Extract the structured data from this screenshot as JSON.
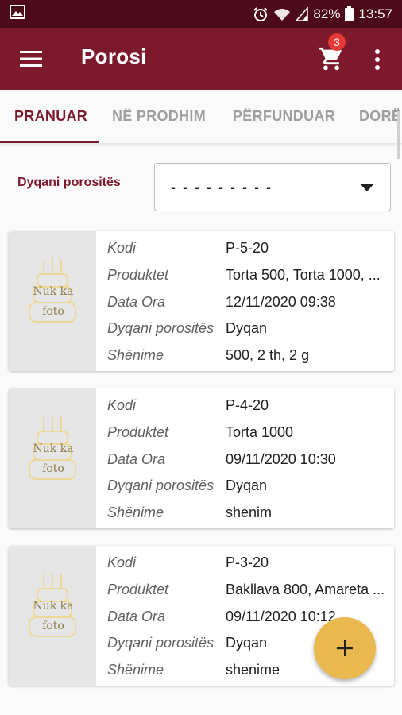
{
  "status_bar": {
    "battery": "82%",
    "time": "13:57",
    "icons": [
      "image-icon",
      "alarm-icon",
      "wifi-icon",
      "signal-icon",
      "battery-icon"
    ]
  },
  "app_bar": {
    "title": "Porosi",
    "cart_count": "3",
    "icons": [
      "menu-icon",
      "cart-icon",
      "more-vert-icon"
    ]
  },
  "tabs": [
    {
      "label": "PRANUAR",
      "active": true
    },
    {
      "label": "NË PRODHIM",
      "active": false
    },
    {
      "label": "PËRFUNDUAR",
      "active": false
    },
    {
      "label": "DORË",
      "active": false
    }
  ],
  "filter": {
    "label": "Dyqani porositës",
    "value": "- - - - - - - - -"
  },
  "orders": [
    {
      "photo_text": [
        "Nuk ka",
        "foto"
      ],
      "fields": [
        {
          "key": "Kodi",
          "value": "P-5-20"
        },
        {
          "key": "Produktet",
          "value": "Torta 500, Torta 1000, ..."
        },
        {
          "key": "Data Ora",
          "value": "12/11/2020 09:38"
        },
        {
          "key": "Dyqani porositës",
          "value": "Dyqan"
        },
        {
          "key": "Shënime",
          "value": "500, 2 th, 2 g"
        }
      ]
    },
    {
      "photo_text": [
        "Nuk ka",
        "foto"
      ],
      "fields": [
        {
          "key": "Kodi",
          "value": "P-4-20"
        },
        {
          "key": "Produktet",
          "value": "Torta 1000"
        },
        {
          "key": "Data Ora",
          "value": "09/11/2020 10:30"
        },
        {
          "key": "Dyqani porositës",
          "value": "Dyqan"
        },
        {
          "key": "Shënime",
          "value": "shenim"
        }
      ]
    },
    {
      "photo_text": [
        "Nuk ka",
        "foto"
      ],
      "fields": [
        {
          "key": "Kodi",
          "value": "P-3-20"
        },
        {
          "key": "Produktet",
          "value": "Bakllava 800, Amareta ..."
        },
        {
          "key": "Data Ora",
          "value": "09/11/2020 10:12"
        },
        {
          "key": "Dyqani porositës",
          "value": "Dyqan"
        },
        {
          "key": "Shënime",
          "value": "shenime"
        }
      ]
    }
  ],
  "fab": {
    "icon": "add-icon"
  },
  "colors": {
    "status_bar": "#4d0a18",
    "primary": "#7c1a2c",
    "accent": "#e9b94f",
    "badge": "#e53935",
    "tab_inactive": "#9e9e9e"
  }
}
